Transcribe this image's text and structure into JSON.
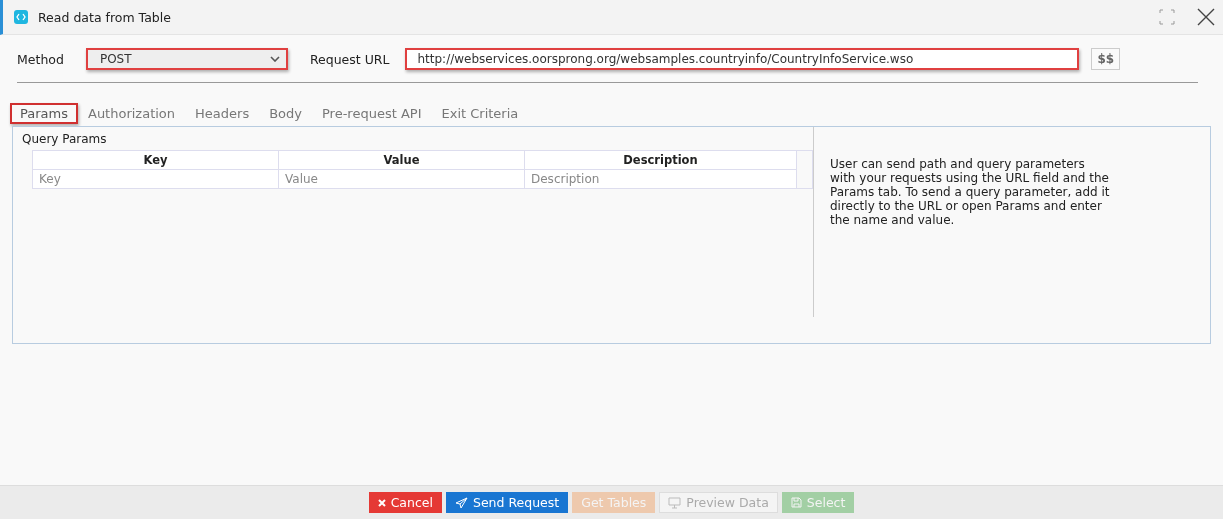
{
  "window": {
    "title": "Read data from Table"
  },
  "method": {
    "label": "Method",
    "value": "POST",
    "highlighted": true
  },
  "request_url": {
    "label": "Request URL",
    "value": "http://webservices.oorsprong.org/websamples.countryinfo/CountryInfoService.wso",
    "highlighted": true,
    "variables_button": "$$"
  },
  "tabs": [
    {
      "label": "Params",
      "selected": true,
      "highlighted": true
    },
    {
      "label": "Authorization",
      "selected": false,
      "highlighted": false
    },
    {
      "label": "Headers",
      "selected": false,
      "highlighted": false
    },
    {
      "label": "Body",
      "selected": false,
      "highlighted": false
    },
    {
      "label": "Pre-request API",
      "selected": false,
      "highlighted": false
    },
    {
      "label": "Exit Criteria",
      "selected": false,
      "highlighted": false
    }
  ],
  "query_params": {
    "title": "Query Params",
    "columns": [
      "Key",
      "Value",
      "Description"
    ],
    "placeholders": [
      "Key",
      "Value",
      "Description"
    ],
    "help_text": "User can send path and query parameters with your requests using the URL field and the Params tab. To send a query parameter, add it directly to the URL or open Params and enter the name and value."
  },
  "buttons": [
    {
      "label": "Cancel",
      "kind": "danger",
      "disabled": false
    },
    {
      "label": "Send Request",
      "kind": "primary",
      "disabled": false
    },
    {
      "label": "Get Tables",
      "kind": "warning",
      "disabled": true
    },
    {
      "label": "Preview Data",
      "kind": "default",
      "disabled": true
    },
    {
      "label": "Select",
      "kind": "success",
      "disabled": true
    }
  ]
}
